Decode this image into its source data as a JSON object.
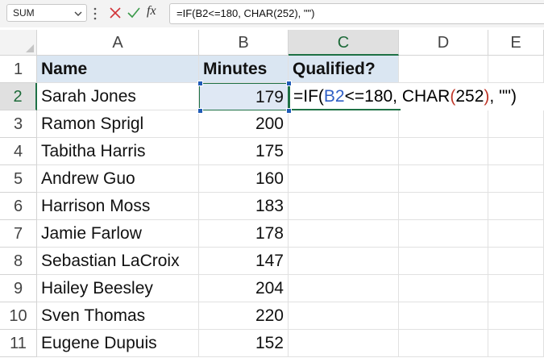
{
  "formula_bar": {
    "name_box": "SUM",
    "formula": "=IF(B2<=180, CHAR(252), \"\")",
    "fx_label": "fx",
    "icons": [
      "chevron-down-icon",
      "more-vertical-icon",
      "cancel-icon",
      "enter-icon",
      "insert-function-icon"
    ]
  },
  "columns": [
    "A",
    "B",
    "C",
    "D",
    "E"
  ],
  "active_column": "C",
  "rows": [
    "1",
    "2",
    "3",
    "4",
    "5",
    "6",
    "7",
    "8",
    "9",
    "10",
    "11"
  ],
  "active_row": "2",
  "header_row": {
    "name": "Name",
    "minutes": "Minutes",
    "qualified": "Qualified?"
  },
  "data": [
    {
      "name": "Sarah Jones",
      "minutes": "179"
    },
    {
      "name": "Ramon Sprigl",
      "minutes": "200"
    },
    {
      "name": "Tabitha Harris",
      "minutes": "175"
    },
    {
      "name": "Andrew Guo",
      "minutes": "160"
    },
    {
      "name": "Harrison Moss",
      "minutes": "183"
    },
    {
      "name": "Jamie Farlow",
      "minutes": "178"
    },
    {
      "name": "Sebastian LaCroix",
      "minutes": "147"
    },
    {
      "name": "Hailey Beesley",
      "minutes": "204"
    },
    {
      "name": "Sven Thomas",
      "minutes": "220"
    },
    {
      "name": "Eugene Dupuis",
      "minutes": "152"
    }
  ],
  "editing_cell": {
    "part1": "=IF(",
    "ref": "B2",
    "part2": "<=180, CHAR",
    "paren_open": "(",
    "arg": "252",
    "paren_close": ")",
    "part3": ", \"\")"
  },
  "colors": {
    "accent": "#1e7145",
    "header_fill": "#dae6f2",
    "ref_blue": "#2f5fc5",
    "paren_red": "#c0392b"
  }
}
